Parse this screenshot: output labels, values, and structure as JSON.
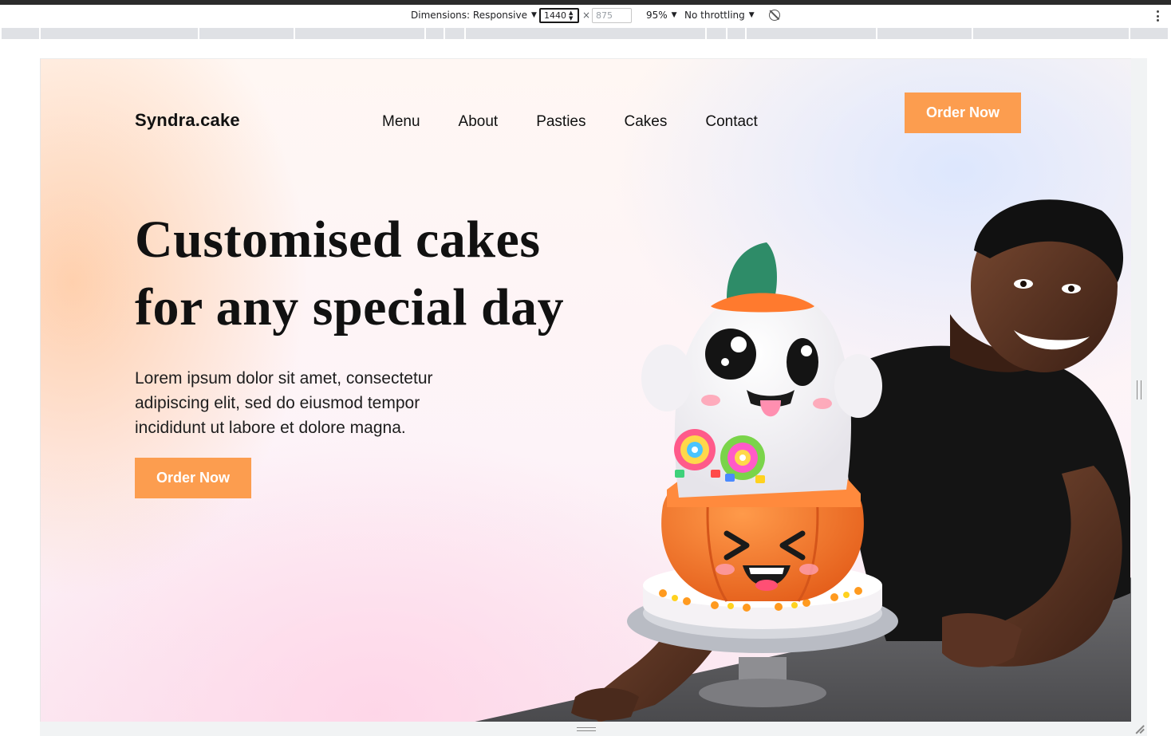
{
  "devtools": {
    "dimensions_label": "Dimensions: Responsive",
    "width_value": "1440",
    "height_placeholder": "875",
    "times_symbol": "×",
    "zoom": "95%",
    "throttling": "No throttling",
    "caret": "▼",
    "spin_up": "▲",
    "spin_down": "▼",
    "icons": [
      "rotate-icon",
      "more-options-icon",
      "resize-handle-icon"
    ]
  },
  "site": {
    "logo": "Syndra.cake",
    "nav": [
      "Menu",
      "About",
      "Pasties",
      "Cakes",
      "Contact"
    ],
    "nav_cta": "Order Now",
    "hero": {
      "headline_line1": "Customised cakes",
      "headline_line2": "for any special day",
      "description": "Lorem ipsum dolor sit amet, consectetur adipiscing elit, sed do eiusmod tempor incididunt ut labore et dolore magna.",
      "cta": "Order Now"
    },
    "colors": {
      "accent": "#fc9d4f",
      "text": "#111111"
    }
  }
}
